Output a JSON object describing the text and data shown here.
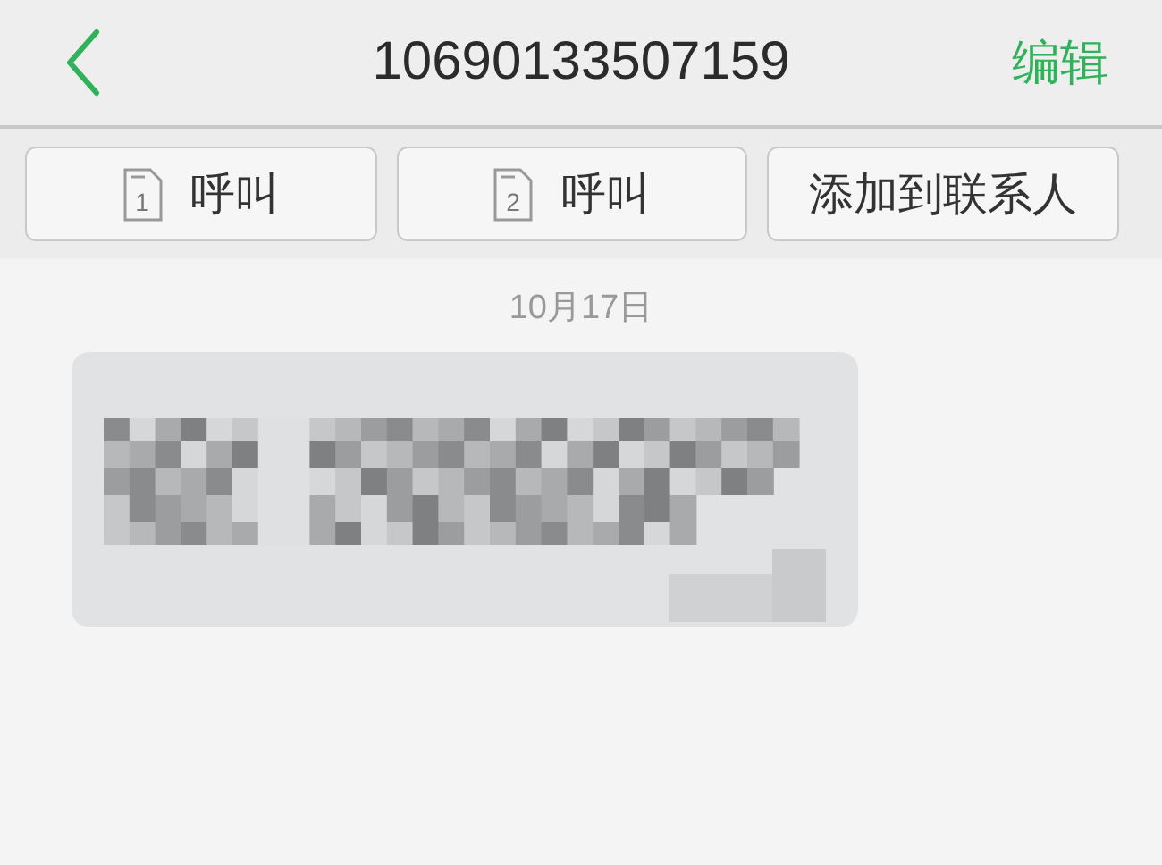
{
  "header": {
    "title": "10690133507159",
    "action": "编辑"
  },
  "actions": [
    {
      "kind": "sim_call",
      "sim": "1",
      "label": "呼叫"
    },
    {
      "kind": "sim_call",
      "sim": "2",
      "label": "呼叫"
    },
    {
      "kind": "plain",
      "label": "添加到联系人"
    }
  ],
  "messages": [
    {
      "date": "10月17日",
      "kind": "redacted"
    }
  ]
}
